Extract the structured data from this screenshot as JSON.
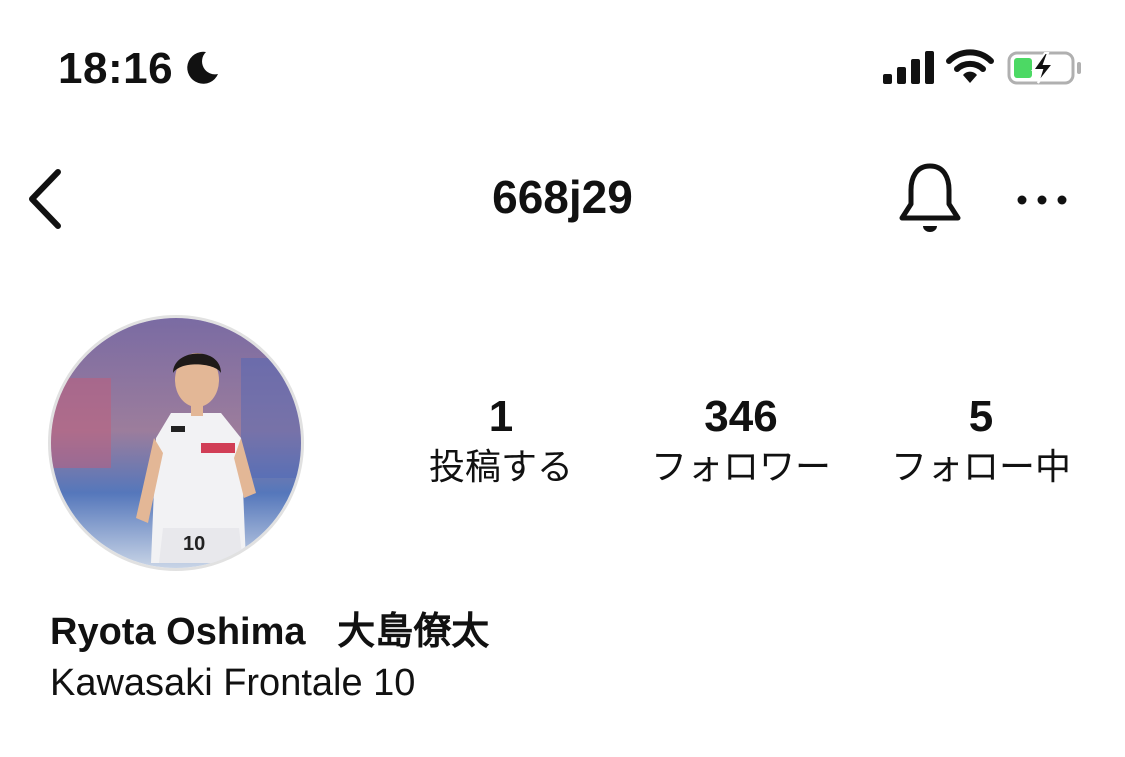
{
  "status_bar": {
    "time": "18:16",
    "icons": [
      "moon-icon",
      "cellular-signal-icon",
      "wifi-icon",
      "battery-charging-icon"
    ],
    "battery_color": "#4cd964"
  },
  "header": {
    "username": "668j29",
    "icons": [
      "chevron-left-icon",
      "bell-icon",
      "ellipsis-icon"
    ]
  },
  "profile": {
    "avatar_icon": "profile-photo",
    "stats": [
      {
        "value": "1",
        "label": "投稿する"
      },
      {
        "value": "346",
        "label": "フォロワー"
      },
      {
        "value": "5",
        "label": "フォロー中"
      }
    ],
    "display_name": "Ryota Oshima   大島僚太",
    "bio": "Kawasaki Frontale 10"
  }
}
